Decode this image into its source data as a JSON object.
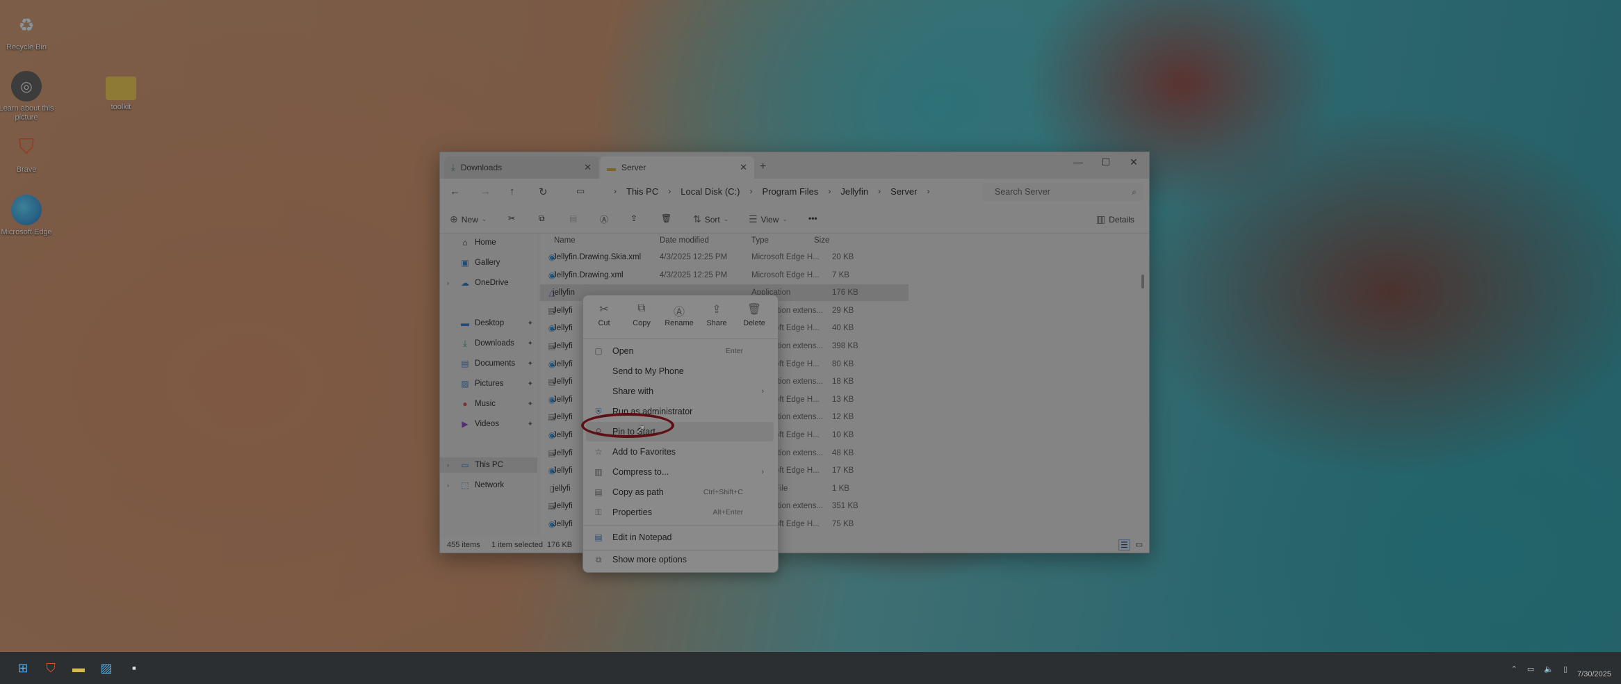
{
  "desktop": {
    "icons": [
      {
        "label": "Recycle Bin",
        "icon": "recycle-bin-icon"
      },
      {
        "label": "Learn about this picture",
        "icon": "camera-icon"
      },
      {
        "label": "toolkit",
        "icon": "folder-icon"
      },
      {
        "label": "Brave",
        "icon": "brave-icon"
      },
      {
        "label": "Microsoft Edge",
        "icon": "edge-icon"
      }
    ]
  },
  "window": {
    "tabs": [
      {
        "label": "Downloads",
        "icon": "download-icon"
      },
      {
        "label": "Server",
        "icon": "folder-icon"
      }
    ],
    "breadcrumb": [
      "This PC",
      "Local Disk (C:)",
      "Program Files",
      "Jellyfin",
      "Server"
    ],
    "search_placeholder": "Search Server",
    "toolbar": {
      "new_label": "New",
      "sort_label": "Sort",
      "view_label": "View",
      "details_label": "Details"
    },
    "nav": [
      {
        "label": "Home",
        "icon": "home-icon"
      },
      {
        "label": "Gallery",
        "icon": "gallery-icon"
      },
      {
        "label": "OneDrive",
        "icon": "cloud-icon"
      },
      {
        "label": "Desktop",
        "icon": "desktop-icon"
      },
      {
        "label": "Downloads",
        "icon": "download-icon"
      },
      {
        "label": "Documents",
        "icon": "documents-icon"
      },
      {
        "label": "Pictures",
        "icon": "pictures-icon"
      },
      {
        "label": "Music",
        "icon": "music-icon"
      },
      {
        "label": "Videos",
        "icon": "videos-icon"
      },
      {
        "label": "This PC",
        "icon": "pc-icon"
      },
      {
        "label": "Network",
        "icon": "network-icon"
      }
    ],
    "columns": {
      "name": "Name",
      "date": "Date modified",
      "type": "Type",
      "size": "Size"
    },
    "files": [
      {
        "name": "Jellyfin.Drawing.Skia.xml",
        "date": "4/3/2025 12:25 PM",
        "type": "Microsoft Edge H...",
        "size": "20 KB"
      },
      {
        "name": "Jellyfin.Drawing.xml",
        "date": "4/3/2025 12:25 PM",
        "type": "Microsoft Edge H...",
        "size": "7 KB"
      },
      {
        "name": "jellyfin",
        "date": "",
        "type": "Application",
        "size": "176 KB"
      },
      {
        "name": "Jellyfi",
        "date": "",
        "type": "Application extens...",
        "size": "29 KB"
      },
      {
        "name": "Jellyfi",
        "date": "",
        "type": "Microsoft Edge H...",
        "size": "40 KB"
      },
      {
        "name": "Jellyfi",
        "date": "",
        "type": "Application extens...",
        "size": "398 KB"
      },
      {
        "name": "Jellyfi",
        "date": "",
        "type": "Microsoft Edge H...",
        "size": "80 KB"
      },
      {
        "name": "Jellyfi",
        "date": "",
        "type": "Application extens...",
        "size": "18 KB"
      },
      {
        "name": "Jellyfi",
        "date": "",
        "type": "Microsoft Edge H...",
        "size": "13 KB"
      },
      {
        "name": "Jellyfi",
        "date": "",
        "type": "Application extens...",
        "size": "12 KB"
      },
      {
        "name": "Jellyfi",
        "date": "",
        "type": "Microsoft Edge H...",
        "size": "10 KB"
      },
      {
        "name": "Jellyfi",
        "date": "",
        "type": "Application extens...",
        "size": "48 KB"
      },
      {
        "name": "Jellyfi",
        "date": "",
        "type": "Microsoft Edge H...",
        "size": "17 KB"
      },
      {
        "name": "jellyfi",
        "date": "",
        "type": "JSON File",
        "size": "1 KB"
      },
      {
        "name": "Jellyfi",
        "date": "",
        "type": "Application extens...",
        "size": "351 KB"
      },
      {
        "name": "Jellyfi",
        "date": "",
        "type": "Microsoft Edge H...",
        "size": "75 KB"
      }
    ],
    "status": {
      "count": "455 items",
      "selected": "1 item selected",
      "size": "176 KB"
    }
  },
  "context_menu": {
    "quick_actions": [
      {
        "label": "Cut",
        "icon": "scissors-icon"
      },
      {
        "label": "Copy",
        "icon": "copy-icon"
      },
      {
        "label": "Rename",
        "icon": "rename-icon"
      },
      {
        "label": "Share",
        "icon": "share-icon"
      },
      {
        "label": "Delete",
        "icon": "trash-icon"
      }
    ],
    "items": [
      {
        "label": "Open",
        "shortcut": "Enter",
        "icon": "open-icon"
      },
      {
        "label": "Send to My Phone",
        "shortcut": "",
        "icon": "phone-icon"
      },
      {
        "label": "Share with",
        "shortcut": "",
        "icon": "share-with-icon"
      },
      {
        "label": "Run as administrator",
        "shortcut": "",
        "icon": "shield-icon"
      },
      {
        "label": "Pin to Start",
        "shortcut": "",
        "icon": "pin-icon"
      },
      {
        "label": "Add to Favorites",
        "shortcut": "",
        "icon": "star-icon"
      },
      {
        "label": "Compress to...",
        "shortcut": "",
        "icon": "zip-icon"
      },
      {
        "label": "Copy as path",
        "shortcut": "Ctrl+Shift+C",
        "icon": "path-icon"
      },
      {
        "label": "Properties",
        "shortcut": "Alt+Enter",
        "icon": "properties-icon"
      },
      {
        "label": "Edit in Notepad",
        "shortcut": "",
        "icon": "notepad-icon"
      },
      {
        "label": "Show more options",
        "shortcut": "",
        "icon": "more-options-icon"
      }
    ]
  },
  "taskbar": {
    "clock": "7/30/2025"
  }
}
